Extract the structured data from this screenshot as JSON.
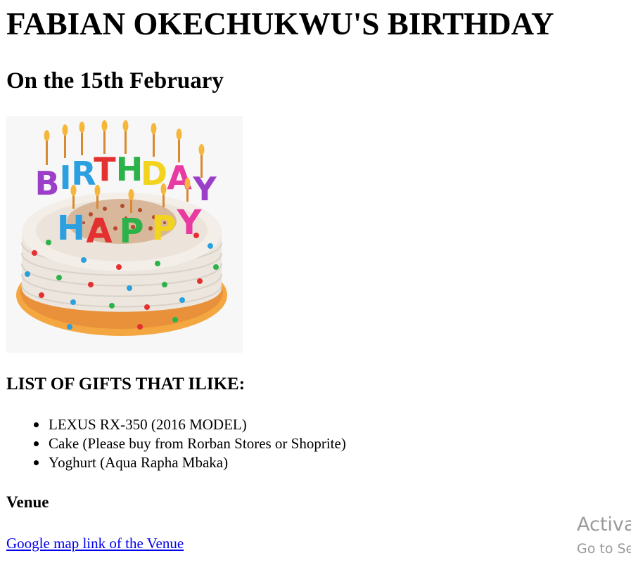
{
  "page": {
    "title": "FABIAN OKECHUKWU'S BIRTHDAY",
    "date_heading": "On the 15th February",
    "cake_image": {
      "letters_top": [
        "B",
        "I",
        "R",
        "T",
        "H",
        "D",
        "A",
        "Y"
      ],
      "letters_bottom": [
        "H",
        "A",
        "P",
        "P",
        "Y"
      ],
      "colors": {
        "purple": "#9b3fc8",
        "blue": "#2aa0e0",
        "red": "#e43030",
        "green": "#2bb34a",
        "yellow": "#f2d41e",
        "pink": "#e83aa0",
        "frosting": "#f1ece6",
        "base": "#f4a640"
      }
    },
    "gifts": {
      "heading": "LIST OF GIFTS THAT ILIKE:",
      "items": [
        "LEXUS RX-350 (2016 MODEL)",
        "Cake (Please buy from Rorban Stores or Shoprite)",
        "Yoghurt (Aqua Rapha Mbaka)"
      ]
    },
    "venue": {
      "heading": "Venue",
      "link_text": "Google map link of the Venue"
    },
    "watermark": {
      "line1": "Activa",
      "line2": "Go to Se"
    },
    "link_color": "#0000ee"
  }
}
